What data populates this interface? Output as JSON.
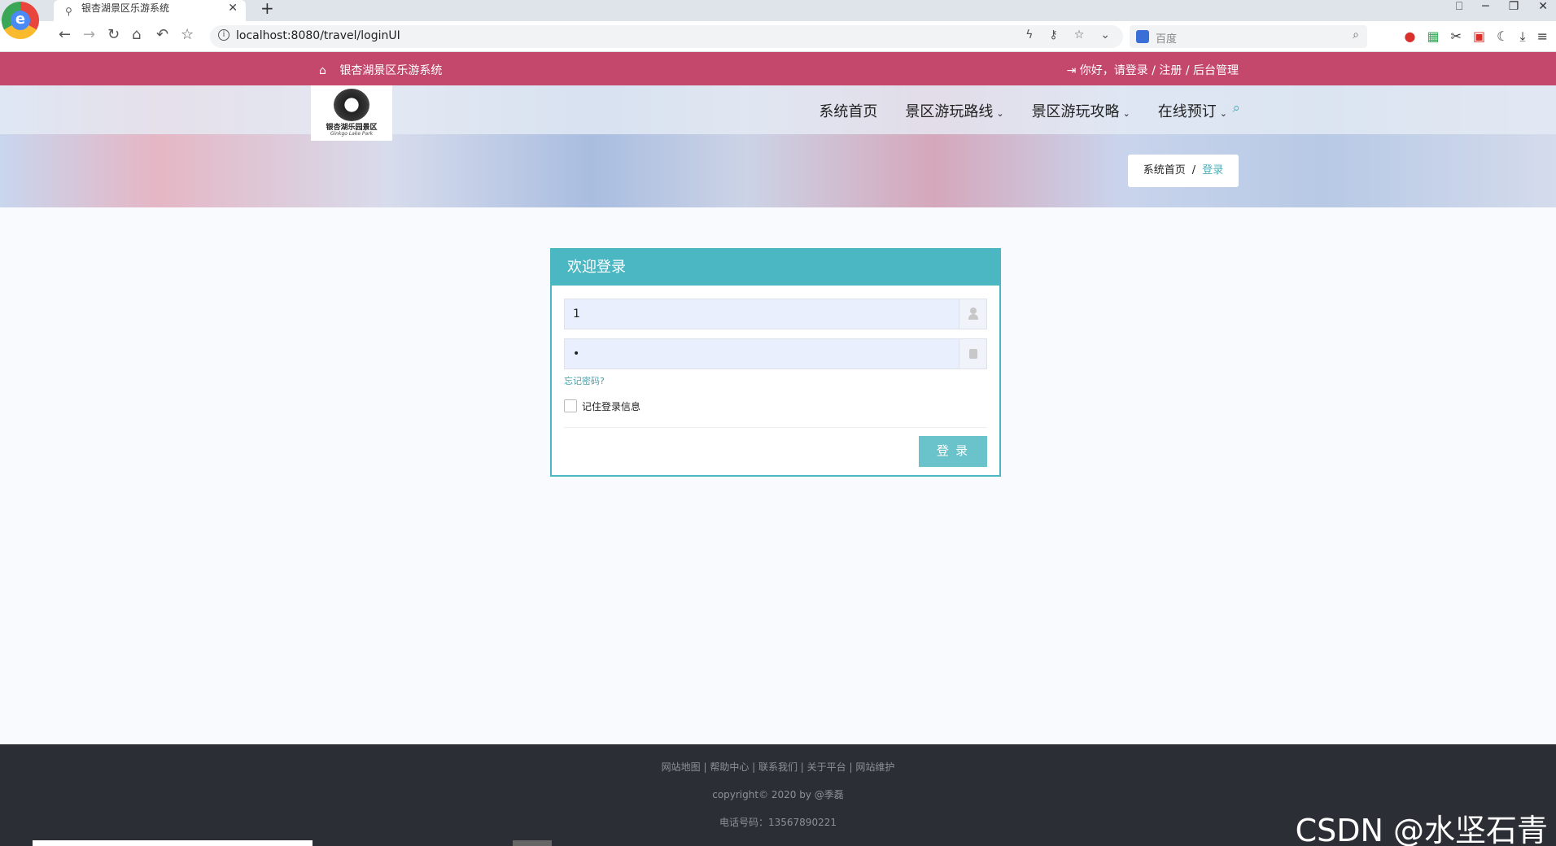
{
  "browser": {
    "tab_title": "银杏湖景区乐游系统",
    "url": "localhost:8080/travel/loginUI",
    "search_placeholder": "百度"
  },
  "topbar": {
    "site_name": "银杏湖景区乐游系统",
    "greeting": "你好，请登录",
    "register": "注册",
    "admin": "后台管理"
  },
  "header": {
    "logo_text": "银杏湖乐园景区",
    "nav": {
      "home": "系统首页",
      "routes": "景区游玩路线",
      "guides": "景区游玩攻略",
      "booking": "在线预订"
    }
  },
  "breadcrumb": {
    "home": "系统首页",
    "current": "登录"
  },
  "login": {
    "title": "欢迎登录",
    "username_value": "1",
    "password_value": "•",
    "forgot_label": "忘记密码?",
    "remember_label": "记住登录信息",
    "remember_checked": false,
    "submit_label": "登 录"
  },
  "footer": {
    "links": "网站地图 | 帮助中心 | 联系我们 | 关于平台 | 网站维护",
    "copyright": "copyright© 2020 by @季磊",
    "phone": "电话号码：13567890221"
  },
  "watermark": "CSDN @水坚石青",
  "colors": {
    "topbar": "#c4486c",
    "accent": "#4ab7c2",
    "footer": "#2b2f35"
  }
}
